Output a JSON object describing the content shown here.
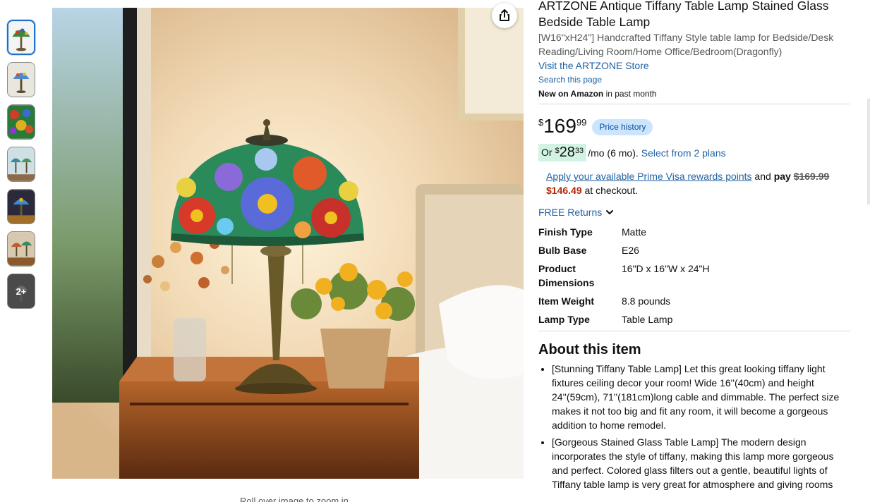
{
  "product": {
    "title": "ARTZONE Antique Tiffany Table Lamp Stained Glass Bedside Table Lamp",
    "subtitle": "[W16\"xH24\"] Handcrafted Tiffany Style table lamp for Bedside/Desk Reading/Living Room/Home Office/Bedroom(Dragonfly)",
    "store_link": "Visit the ARTZONE Store",
    "search_page": "Search this page",
    "new_on_amazon_bold": "New on Amazon",
    "new_on_amazon_rest": " in past month"
  },
  "gallery": {
    "thumbnail_count": 6,
    "more_label": "2+",
    "caption": "Roll over image to zoom in"
  },
  "price": {
    "currency": "$",
    "whole": "169",
    "fraction": "99",
    "history_badge": "Price history"
  },
  "monthly": {
    "or_label": "Or",
    "currency": "$",
    "whole": "28",
    "fraction": "33",
    "per": "/mo (6 mo).",
    "plans_link": "Select from 2 plans"
  },
  "visa": {
    "link": "Apply your available Prime Visa rewards points",
    "and": " and ",
    "pay": "pay",
    "original": "$169.99",
    "discounted": "$146.49",
    "suffix": " at checkout."
  },
  "returns": {
    "label": "FREE Returns"
  },
  "specs": [
    {
      "key": "Finish Type",
      "value": "Matte"
    },
    {
      "key": "Bulb Base",
      "value": "E26"
    },
    {
      "key": "Product Dimensions",
      "value": "16\"D x 16\"W x 24\"H"
    },
    {
      "key": "Item Weight",
      "value": "8.8 pounds"
    },
    {
      "key": "Lamp Type",
      "value": "Table Lamp"
    }
  ],
  "about": {
    "heading": "About this item",
    "bullets": [
      "[Stunning Tiffany Table Lamp] Let this great looking tiffany light fixtures ceiling decor your room! Wide 16''(40cm) and height 24''(59cm), 71''(181cm)long cable and dimmable. The perfect size makes it not too big and fit any room, it will become a gorgeous addition to home remodel.",
      "[Gorgeous Stained Glass Table Lamp] The modern design incorporates the style of tiffany, making this lamp more gorgeous and perfect. Colored glass filters out a gentle, beautiful lights of Tiffany table lamp is very great for atmosphere and giving rooms"
    ]
  },
  "icons": {
    "share": "share-icon",
    "chevron": "chevron-down-icon"
  },
  "colors": {
    "link": "#2162a1",
    "deal_red": "#b12704",
    "badge_bg": "#cce5ff",
    "monthly_bg": "#d2f3e1"
  }
}
